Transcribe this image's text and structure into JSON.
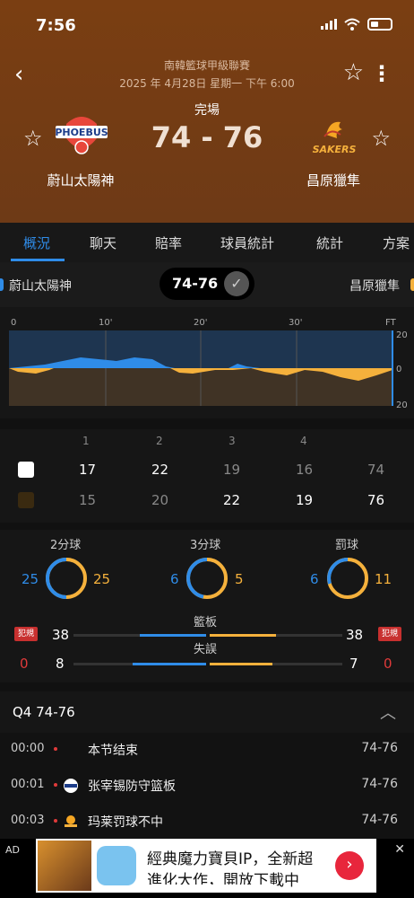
{
  "status_bar": {
    "time": "7:56"
  },
  "header": {
    "league": "南韓籃球甲級聯賽",
    "datetime": "2025 年 4月28日 星期一 下午 6:00",
    "match_status": "完場",
    "score": "74 - 76",
    "home": {
      "name": "蔚山太陽神",
      "logo_text": "PHOEBUS"
    },
    "away": {
      "name": "昌原獵隼",
      "logo_text": "SAKERS"
    }
  },
  "tabs": [
    "概況",
    "聊天",
    "賠率",
    "球員統計",
    "統計",
    "方案"
  ],
  "scorebar": {
    "home": "蔚山太陽神",
    "away": "昌原獵隼",
    "score": "74-76"
  },
  "momentum": {
    "x_labels": [
      "0",
      "10'",
      "20'",
      "30'",
      "FT"
    ],
    "y_labels": [
      "20",
      "0",
      "20"
    ]
  },
  "quarters": {
    "headers": [
      "1",
      "2",
      "3",
      "4"
    ],
    "home": [
      "17",
      "22",
      "19",
      "16",
      "74"
    ],
    "away": [
      "15",
      "20",
      "22",
      "19",
      "76"
    ]
  },
  "stats": {
    "two_pt": {
      "label": "2分球",
      "home": "25",
      "away": "25"
    },
    "three_pt": {
      "label": "3分球",
      "home": "6",
      "away": "5"
    },
    "free_throw": {
      "label": "罰球",
      "home": "6",
      "away": "11"
    },
    "foul_label": "犯規",
    "fouls": {
      "home": "0",
      "away": "0"
    },
    "rebounds": {
      "label": "籃板",
      "home": "38",
      "away": "38"
    },
    "turnovers": {
      "label": "失誤",
      "home": "8",
      "away": "7"
    }
  },
  "q4": {
    "title": "Q4  74-76"
  },
  "plays": [
    {
      "time": "00:00",
      "text": "本节结束",
      "score": "74-76"
    },
    {
      "time": "00:01",
      "text": "张宰锡防守篮板",
      "score": "74-76"
    },
    {
      "time": "00:03",
      "text": "玛莱罚球不中",
      "score": "74-76"
    }
  ],
  "ad": {
    "tag": "AD",
    "line1": "經典魔力寶貝IP，全新超",
    "line2": "進化大作，開放下載中"
  },
  "colors": {
    "home": "#2f8ce8",
    "away": "#f5b13c",
    "hero_bg": "#7a3e12"
  }
}
